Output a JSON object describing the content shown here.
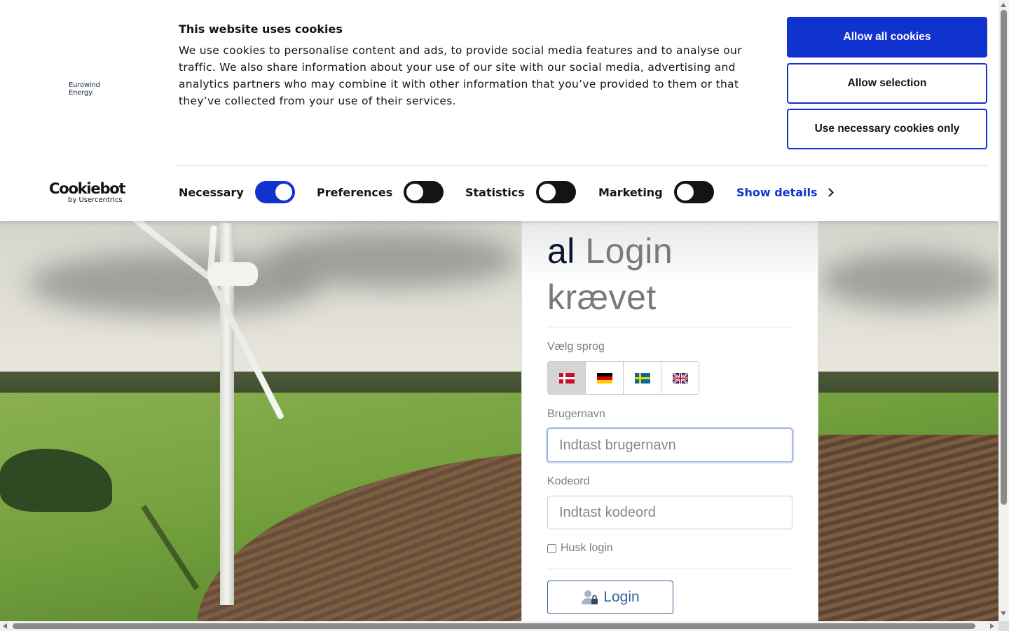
{
  "cookie_banner": {
    "brand_line1": "Eurowind",
    "brand_line2": "Energy.",
    "title": "This website uses cookies",
    "description": "We use cookies to personalise content and ads, to provide social media features and to analyse our traffic. We also share information about your use of our site with our social media, advertising and analytics partners who may combine it with other information that you’ve provided to them or that they’ve collected from your use of their services.",
    "allow_all_label": "Allow all cookies",
    "allow_selection_label": "Allow selection",
    "necessary_only_label": "Use necessary cookies only",
    "cookiebot_logo": "Cookiebot",
    "cookiebot_sub": "by Usercentrics",
    "toggles": [
      {
        "label": "Necessary",
        "on": true
      },
      {
        "label": "Preferences",
        "on": false
      },
      {
        "label": "Statistics",
        "on": false
      },
      {
        "label": "Marketing",
        "on": false
      }
    ],
    "show_details_label": "Show details",
    "accent_color": "#1032cf"
  },
  "login": {
    "title_strong": "al",
    "title_rest1": "Login",
    "title_rest2": "krævet",
    "language_label": "Vælg sprog",
    "languages": [
      {
        "code": "da",
        "icon": "danish-flag-icon",
        "active": true
      },
      {
        "code": "de",
        "icon": "german-flag-icon",
        "active": false
      },
      {
        "code": "sv",
        "icon": "swedish-flag-icon",
        "active": false
      },
      {
        "code": "en",
        "icon": "uk-flag-icon",
        "active": false
      }
    ],
    "username_label": "Brugernavn",
    "username_placeholder": "Indtast brugernavn",
    "password_label": "Kodeord",
    "password_placeholder": "Indtast kodeord",
    "remember_label": "Husk login",
    "login_button_label": "Login",
    "login_icon": "user-lock-icon"
  }
}
